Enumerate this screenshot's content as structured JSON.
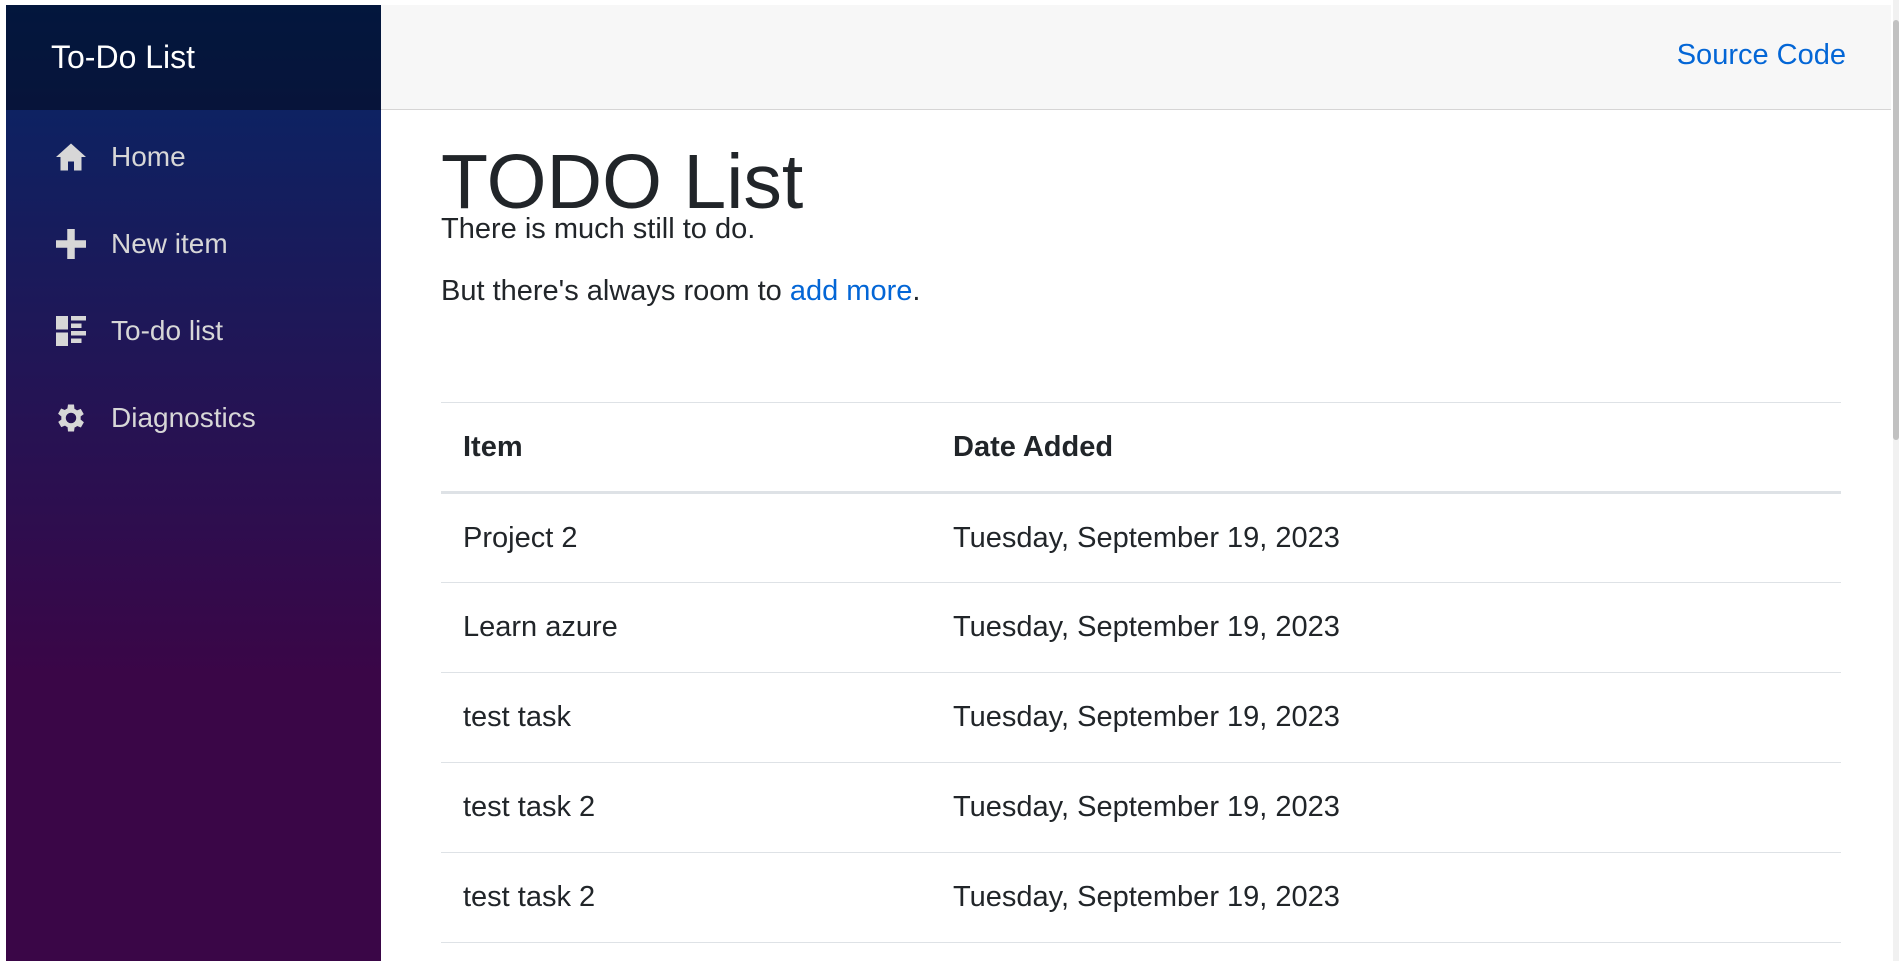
{
  "sidebar": {
    "brand": "To-Do List",
    "items": [
      {
        "label": "Home",
        "icon": "home-icon"
      },
      {
        "label": "New item",
        "icon": "plus-icon"
      },
      {
        "label": "To-do list",
        "icon": "list-icon"
      },
      {
        "label": "Diagnostics",
        "icon": "gear-icon"
      }
    ]
  },
  "topbar": {
    "source_link": "Source Code"
  },
  "main": {
    "title": "TODO List",
    "subtitle": "There is much still to do.",
    "room_text_before": "But there's always room to ",
    "room_link": "add more",
    "room_text_after": ".",
    "table": {
      "headers": [
        "Item",
        "Date Added"
      ],
      "rows": [
        [
          "Project 2",
          "Tuesday, September 19, 2023"
        ],
        [
          "Learn azure",
          "Tuesday, September 19, 2023"
        ],
        [
          "test task",
          "Tuesday, September 19, 2023"
        ],
        [
          "test task 2",
          "Tuesday, September 19, 2023"
        ],
        [
          "test task 2",
          "Tuesday, September 19, 2023"
        ]
      ]
    }
  },
  "colors": {
    "sidebar_top": "#052767",
    "sidebar_bottom": "#3a0647",
    "link": "#0366d6"
  }
}
